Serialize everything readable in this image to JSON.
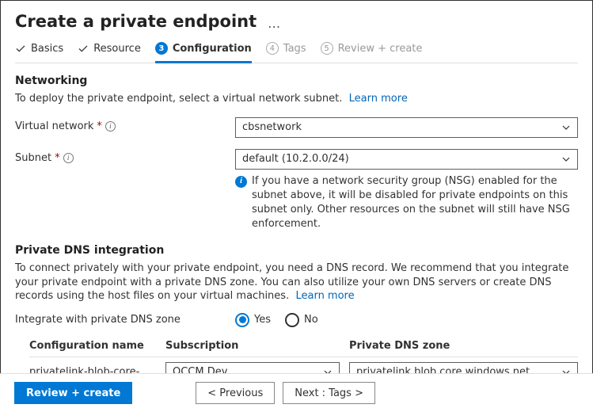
{
  "header": {
    "title": "Create a private endpoint",
    "more_label": "…"
  },
  "steps": {
    "basics": "Basics",
    "resource": "Resource",
    "configuration": "Configuration",
    "tags_num": "4",
    "tags": "Tags",
    "review_num": "5",
    "review": "Review + create",
    "active_num": "3"
  },
  "networking": {
    "heading": "Networking",
    "desc": "To deploy the private endpoint, select a virtual network subnet.",
    "learn": "Learn more",
    "vnet_label": "Virtual network",
    "vnet_value": "cbsnetwork",
    "subnet_label": "Subnet",
    "subnet_value": "default (10.2.0.0/24)",
    "subnet_note": "If you have a network security group (NSG) enabled for the subnet above, it will be disabled for private endpoints on this subnet only. Other resources on the subnet will still have NSG enforcement."
  },
  "dns": {
    "heading": "Private DNS integration",
    "desc": "To connect privately with your private endpoint, you need a DNS record. We recommend that you integrate your private endpoint with a private DNS zone. You can also utilize your own DNS servers or create DNS records using the host files on your virtual machines.",
    "learn": "Learn more",
    "integrate_label": "Integrate with private DNS zone",
    "yes": "Yes",
    "no": "No",
    "col_conf": "Configuration name",
    "col_sub": "Subscription",
    "col_zone": "Private DNS zone",
    "row": {
      "conf": "privatelink-blob-core-...",
      "sub": "OCCM Dev",
      "zone": "privatelink.blob.core.windows.net"
    }
  },
  "footer": {
    "review": "Review + create",
    "prev": "< Previous",
    "next": "Next : Tags >"
  }
}
